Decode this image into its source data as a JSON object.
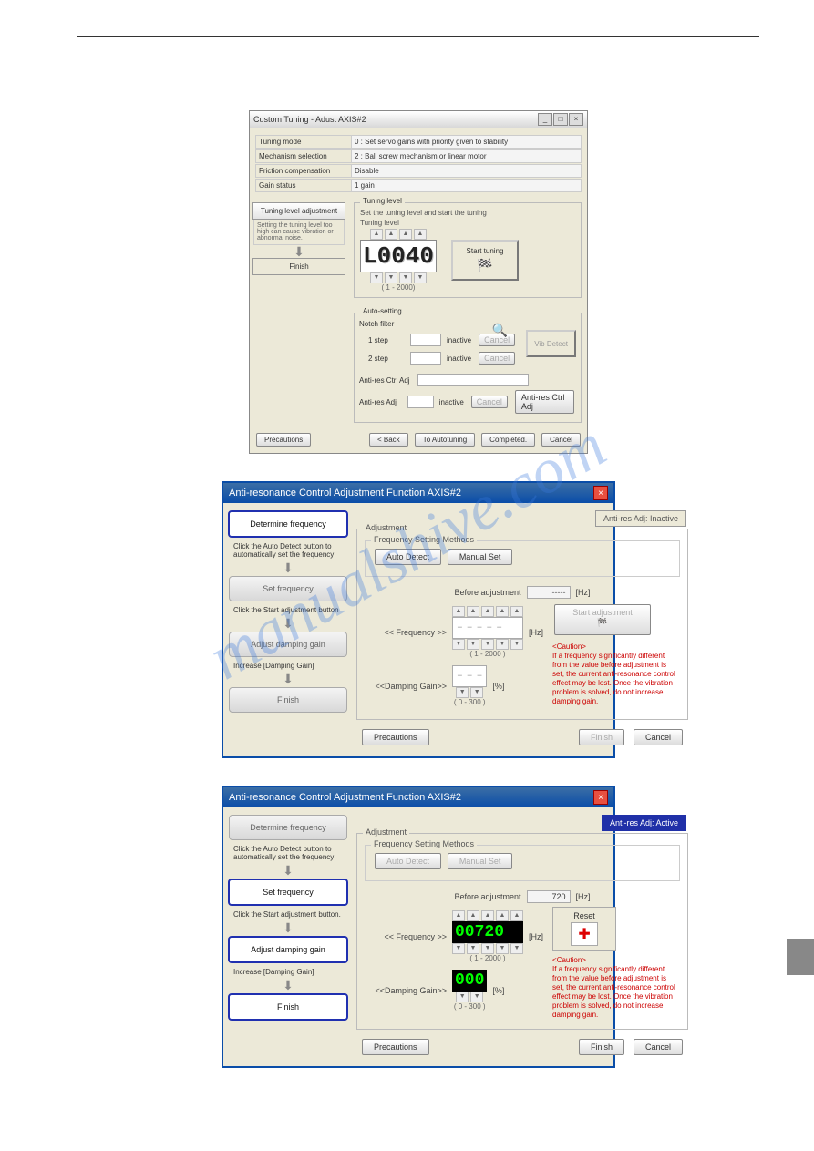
{
  "dlg1": {
    "title": "Custom Tuning - Adust AXIS#2",
    "rows": {
      "mode_k": "Tuning mode",
      "mode_v": "0 : Set servo gains with priority given to stability",
      "mech_k": "Mechanism selection",
      "mech_v": "2 : Ball screw mechanism or linear motor",
      "fric_k": "Friction compensation",
      "fric_v": "Disable",
      "gain_k": "Gain status",
      "gain_v": "1 gain"
    },
    "flow": {
      "box1": "Tuning level adjustment",
      "hint": "Setting the tuning level too high can cause vibration or abnormal noise.",
      "box2": "Finish"
    },
    "tuning": {
      "legend": "Tuning level",
      "sub": "Set the tuning level and start the tuning",
      "label": "Tuning level",
      "digits": "L0040",
      "range": "( 1 - 2000)",
      "start": "Start tuning"
    },
    "auto": {
      "legend": "Auto-setting",
      "notch": "Notch filter",
      "s1": "1 step",
      "s2": "2 step",
      "inactive": "inactive",
      "cancel": "Cancel",
      "anti_ctrl": "Anti-res Ctrl Adj",
      "anti_adj": "Anti-res Adj",
      "vib": "Vib Detect",
      "anti_btn": "Anti-res Ctrl Adj"
    },
    "footer": {
      "prec": "Precautions",
      "back": "< Back",
      "toauto": "To Autotuning",
      "comp": "Completed.",
      "cancel": "Cancel"
    }
  },
  "dlg2a": {
    "title": "Anti-resonance Control Adjustment Function AXIS#2",
    "status": "Anti-res Adj: Inactive",
    "steps": {
      "s1": "Determine frequency",
      "h1": "Click the Auto Detect button to automatically set the frequency",
      "s2": "Set frequency",
      "h2": "Click the Start adjustment button",
      "s3": "Adjust damping gain",
      "h3": "Increase [Damping Gain]",
      "s4": "Finish"
    },
    "adj": {
      "legend": "Adjustment",
      "fsm": "Frequency Setting Methods",
      "auto": "Auto Detect",
      "manual": "Manual Set",
      "before": "Before adjustment",
      "bval": "-----",
      "hz": "[Hz]",
      "freq": "<< Frequency >>",
      "fdigits": "-----",
      "frange": "( 1 - 2000 )",
      "start": "Start adjustment",
      "damp": "<<Damping Gain>>",
      "ddigits": "---",
      "pct": "[%]",
      "drange": "( 0 - 300 )",
      "caution_h": "<Caution>",
      "caution": "If a frequency significantly different from the value before adjustment is set, the current anti-resonance control effect may be lost. Once the vibration problem is solved, do not increase damping gain."
    },
    "footer": {
      "prec": "Precautions",
      "finish": "Finish",
      "cancel": "Cancel"
    }
  },
  "dlg2b": {
    "title": "Anti-resonance Control Adjustment Function AXIS#2",
    "status": "Anti-res Adj: Active",
    "steps": {
      "s1": "Determine frequency",
      "h1": "Click the Auto Detect button to automatically set the frequency",
      "s2": "Set frequency",
      "h2": "Click the Start adjustment button.",
      "s3": "Adjust damping gain",
      "h3": "Increase [Damping Gain]",
      "s4": "Finish"
    },
    "adj": {
      "legend": "Adjustment",
      "fsm": "Frequency Setting Methods",
      "auto": "Auto Detect",
      "manual": "Manual Set",
      "before": "Before adjustment",
      "bval": "720",
      "hz": "[Hz]",
      "freq": "<< Frequency >>",
      "fdigits": "00720",
      "frange": "( 1 - 2000 )",
      "reset": "Reset",
      "damp": "<<Damping Gain>>",
      "ddigits": "000",
      "pct": "[%]",
      "drange": "( 0 - 300 )",
      "caution_h": "<Caution>",
      "caution": "If a frequency significantly different from the value before adjustment is set, the current anti-resonance control effect may be lost. Once the vibration problem is solved, do not increase damping gain."
    },
    "footer": {
      "prec": "Precautions",
      "finish": "Finish",
      "cancel": "Cancel"
    }
  },
  "watermark": "manualshive.com"
}
